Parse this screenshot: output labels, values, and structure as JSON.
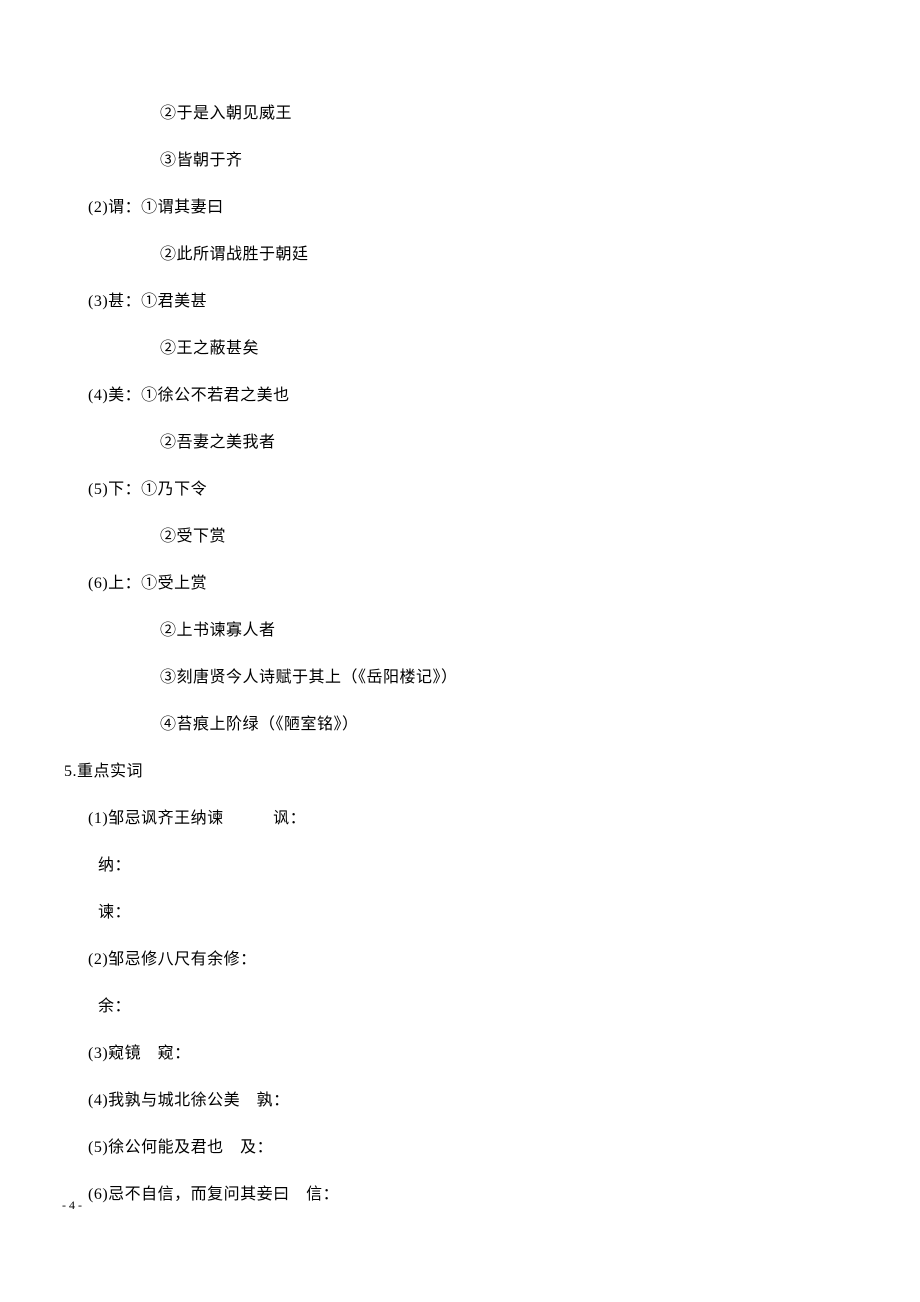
{
  "lines": {
    "l1": "②于是入朝见威王",
    "l2": "③皆朝于齐",
    "l3": "(2)谓：①谓其妻曰",
    "l4": "②此所谓战胜于朝廷",
    "l5": "(3)甚：①君美甚",
    "l6": "②王之蔽甚矣",
    "l7": "(4)美：①徐公不若君之美也",
    "l8": "②吾妻之美我者",
    "l9": "(5)下：①乃下令",
    "l10": "②受下赏",
    "l11": "(6)上：①受上赏",
    "l12": "②上书谏寡人者",
    "l13": "③刻唐贤今人诗赋于其上（《岳阳楼记》）",
    "l14": "④苔痕上阶绿（《陋室铭》）",
    "l15": "5.重点实词",
    "l16": "(1)邹忌讽齐王纳谏　　　讽：",
    "l17": " 纳：",
    "l18": " 谏：",
    "l19": "(2)邹忌修八尺有余修：",
    "l20": " 余：",
    "l21": "(3)窥镜　窥：",
    "l22": "(4)我孰与城北徐公美　孰：",
    "l23": "(5)徐公何能及君也　及：",
    "l24": "(6)忌不自信，而复问其妾曰　信："
  },
  "pageNumber": "- 4 -"
}
